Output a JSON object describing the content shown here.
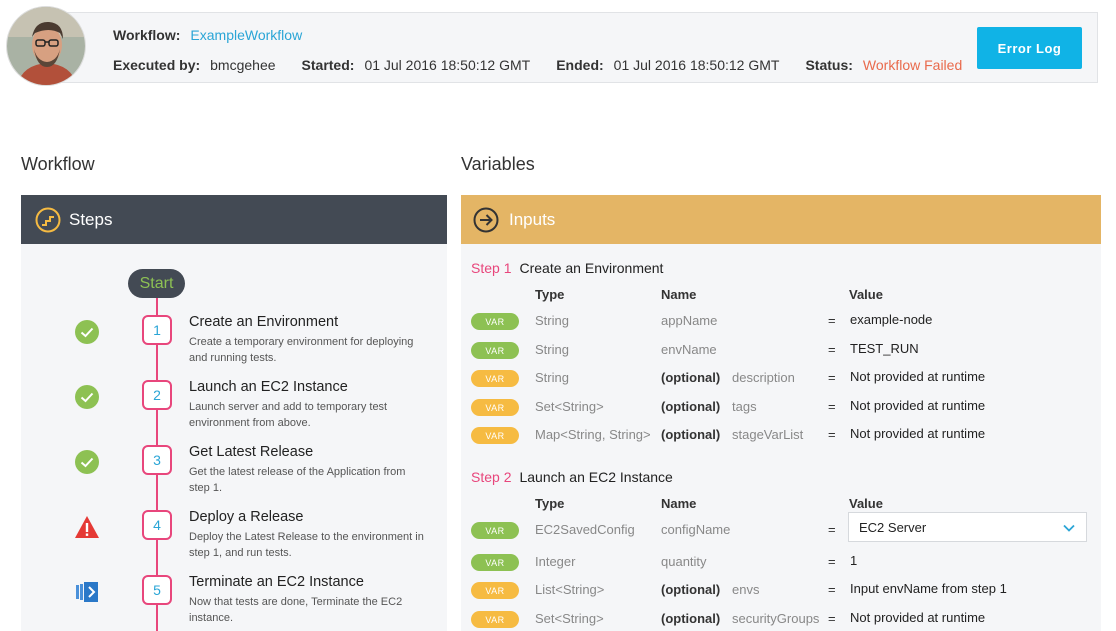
{
  "header": {
    "workflow_label": "Workflow:",
    "workflow_name": "ExampleWorkflow",
    "executed_by_label": "Executed by:",
    "executed_by": "bmcgehee",
    "started_label": "Started:",
    "started": "01 Jul 2016 18:50:12 GMT",
    "ended_label": "Ended:",
    "ended": "01 Jul 2016 18:50:12 GMT",
    "status_label": "Status:",
    "status": "Workflow Failed",
    "error_log_label": "Error Log"
  },
  "workflow_section": {
    "title": "Workflow",
    "steps_header": "Steps",
    "start_label": "Start",
    "steps": [
      {
        "num": "1",
        "title": "Create an Environment",
        "desc": "Create a temporary environment for deploying and running tests.",
        "status": "success"
      },
      {
        "num": "2",
        "title": "Launch an EC2 Instance",
        "desc": "Launch server and add to temporary test environment from above.",
        "status": "success"
      },
      {
        "num": "3",
        "title": "Get Latest Release",
        "desc": "Get the latest release of the Application from step 1.",
        "status": "success"
      },
      {
        "num": "4",
        "title": "Deploy a Release",
        "desc": "Deploy the Latest Release to the environment in step 1, and run tests.",
        "status": "failed"
      },
      {
        "num": "5",
        "title": "Terminate an EC2 Instance",
        "desc": "Now that tests are done, Terminate the EC2 instance.",
        "status": "pending"
      }
    ]
  },
  "variables_section": {
    "title": "Variables",
    "inputs_header": "Inputs",
    "col_type": "Type",
    "col_name": "Name",
    "col_value": "Value",
    "groups": [
      {
        "step_label": "Step 1",
        "step_title": "Create an Environment",
        "rows": [
          {
            "badge": "VAR",
            "badge_color": "green",
            "type": "String",
            "optional": "",
            "name": "appName",
            "eq": "=",
            "value": "example-node"
          },
          {
            "badge": "VAR",
            "badge_color": "green",
            "type": "String",
            "optional": "",
            "name": "envName",
            "eq": "=",
            "value": "TEST_RUN"
          },
          {
            "badge": "VAR",
            "badge_color": "orange",
            "type": "String",
            "optional": "(optional)",
            "name": "description",
            "eq": "=",
            "value": "Not provided at runtime"
          },
          {
            "badge": "VAR",
            "badge_color": "orange",
            "type": "Set<String>",
            "optional": "(optional)",
            "name": "tags",
            "eq": "=",
            "value": "Not provided at runtime"
          },
          {
            "badge": "VAR",
            "badge_color": "orange",
            "type": "Map<String, String>",
            "optional": "(optional)",
            "name": "stageVarList",
            "eq": "=",
            "value": "Not provided at runtime"
          }
        ]
      },
      {
        "step_label": "Step 2",
        "step_title": "Launch an EC2 Instance",
        "rows": [
          {
            "badge": "VAR",
            "badge_color": "green",
            "type": "EC2SavedConfig",
            "optional": "",
            "name": "configName",
            "eq": "=",
            "value": "EC2 Server",
            "is_select": true
          },
          {
            "badge": "VAR",
            "badge_color": "green",
            "type": "Integer",
            "optional": "",
            "name": "quantity",
            "eq": "=",
            "value": "1"
          },
          {
            "badge": "VAR",
            "badge_color": "orange",
            "type": "List<String>",
            "optional": "(optional)",
            "name": "envs",
            "eq": "=",
            "value": "Input envName from step 1"
          },
          {
            "badge": "VAR",
            "badge_color": "orange",
            "type": "Set<String>",
            "optional": "(optional)",
            "name": "securityGroups",
            "eq": "=",
            "value": "Not provided at runtime"
          }
        ]
      }
    ]
  },
  "colors": {
    "accent_blue": "#10b3e6",
    "failed": "#e96a4c",
    "steps_header_bg": "#434a54",
    "inputs_header_bg": "#e4b565",
    "step_line": "#e8467c",
    "success": "#8dc153",
    "warning": "#f6bb42",
    "danger": "#e53935"
  }
}
